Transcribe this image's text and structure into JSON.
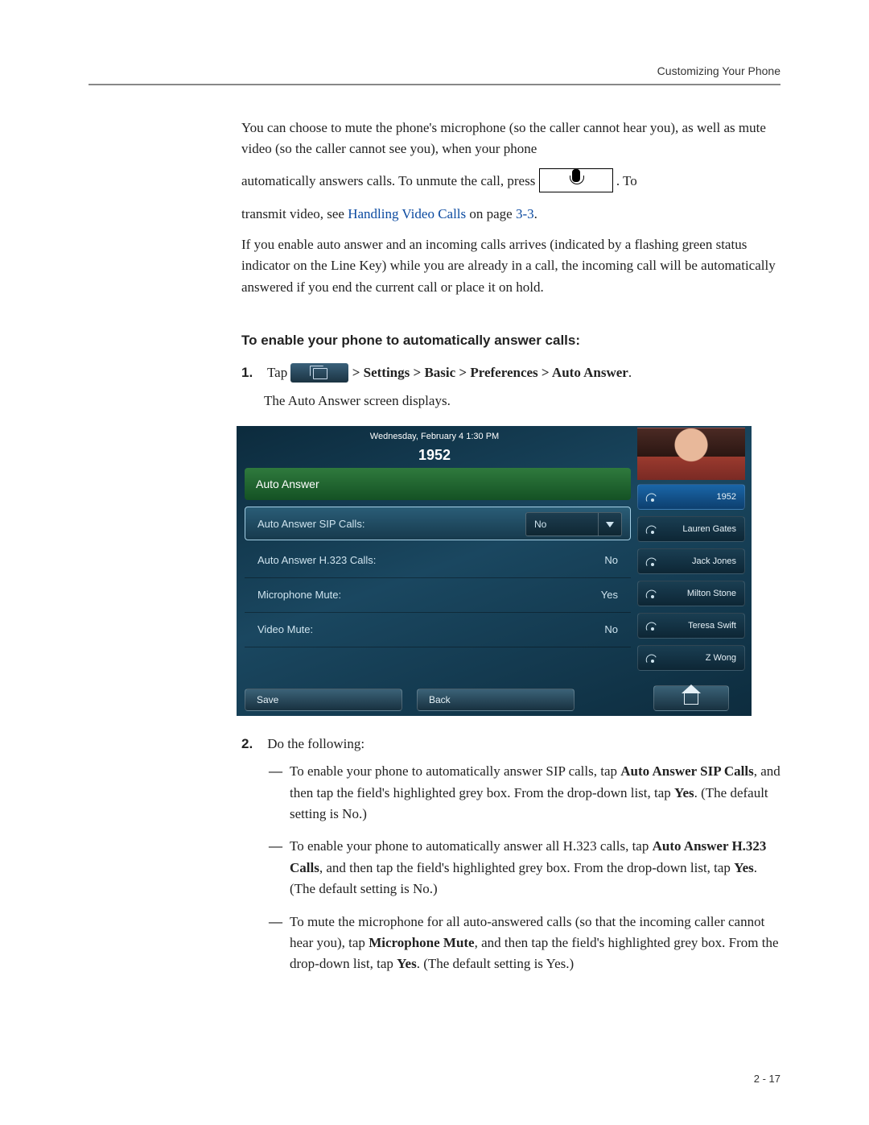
{
  "header": {
    "section": "Customizing Your Phone"
  },
  "intro": {
    "p1a": "You can choose to mute the phone's microphone (so the caller cannot hear you), as well as mute video (so the caller cannot see you), when your phone",
    "p1b_pre": "automatically answers calls. To unmute the call, press ",
    "p1b_post": ". To",
    "p1c_pre": "transmit video, see ",
    "link_text": "Handling Video Calls",
    "p1c_mid": " on page ",
    "page_ref": "3-3",
    "p1c_post": ".",
    "p2": "If you enable auto answer and an incoming calls arrives (indicated by a flashing green status indicator on the Line Key) while you are already in a call, the incoming call will be automatically answered if you end the current call or place it on hold."
  },
  "subheading": "To enable your phone to automatically answer calls:",
  "step1": {
    "num": "1.",
    "pre": "Tap ",
    "path": " > Settings > Basic > Preferences > Auto Answer",
    "post": ".",
    "desc": "The Auto Answer screen displays."
  },
  "phone": {
    "date": "Wednesday, February 4  1:30 PM",
    "number": "1952",
    "section_header": "Auto Answer",
    "settings": [
      {
        "label": "Auto Answer SIP Calls:",
        "value": "No",
        "selected": true
      },
      {
        "label": "Auto Answer H.323 Calls:",
        "value": "No",
        "selected": false
      },
      {
        "label": "Microphone Mute:",
        "value": "Yes",
        "selected": false
      },
      {
        "label": "Video Mute:",
        "value": "No",
        "selected": false
      }
    ],
    "dropdown_value": "No",
    "line_keys": [
      {
        "label": "1952",
        "active": true
      },
      {
        "label": "Lauren Gates",
        "active": false
      },
      {
        "label": "Jack Jones",
        "active": false
      },
      {
        "label": "Milton Stone",
        "active": false
      },
      {
        "label": "Teresa Swift",
        "active": false
      },
      {
        "label": "Z Wong",
        "active": false
      }
    ],
    "softkeys": {
      "save": "Save",
      "back": "Back"
    }
  },
  "step2": {
    "num": "2.",
    "text": "Do the following:",
    "bullets": [
      {
        "pre": "To enable your phone to automatically answer SIP calls, tap ",
        "bold": "Auto Answer SIP Calls",
        "mid": ", and then tap the field's highlighted grey box. From the drop-down list, tap ",
        "bold2": "Yes",
        "post": ". (The default setting is No.)"
      },
      {
        "pre": "To enable your phone to automatically answer all H.323 calls, tap ",
        "bold": "Auto Answer H.323 Calls",
        "mid": ", and then tap the field's highlighted grey box. From the drop-down list, tap ",
        "bold2": "Yes",
        "post": ". (The default setting is No.)"
      },
      {
        "pre": "To mute the microphone for all auto-answered calls (so that the incoming caller cannot hear you), tap ",
        "bold": "Microphone Mute",
        "mid": ", and then tap the field's highlighted grey box. From the drop-down list, tap ",
        "bold2": "Yes",
        "post": ". (The default setting is Yes.)"
      }
    ]
  },
  "footer": {
    "page": "2 - 17"
  }
}
